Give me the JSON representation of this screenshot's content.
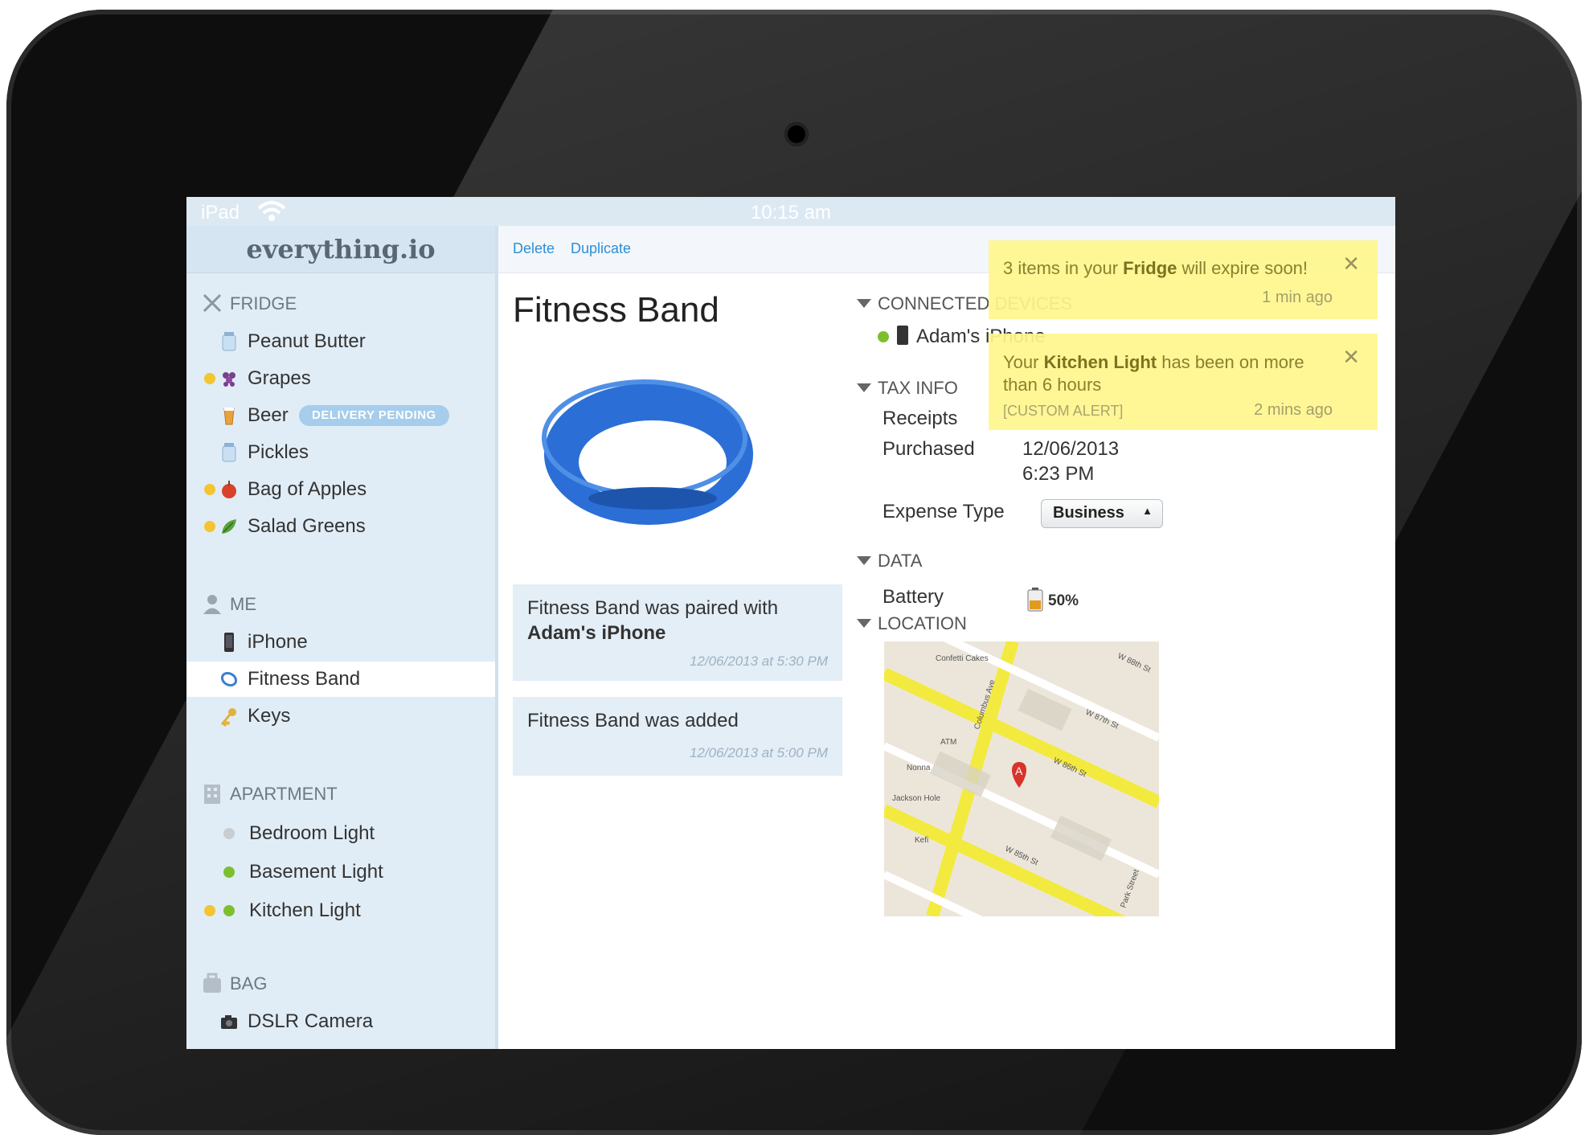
{
  "status_bar": {
    "carrier": "iPad",
    "time": "10:15 am"
  },
  "brand": "everything.io",
  "toolbar": {
    "delete_label": "Delete",
    "duplicate_label": "Duplicate"
  },
  "sidebar": {
    "fridge": {
      "header": "FRIDGE",
      "items": [
        {
          "label": "Peanut Butter",
          "icon": "jar-icon"
        },
        {
          "label": "Grapes",
          "icon": "grapes-icon",
          "alert_dot": true
        },
        {
          "label": "Beer",
          "icon": "beer-icon",
          "badge": "DELIVERY PENDING"
        },
        {
          "label": "Pickles",
          "icon": "jar-icon"
        },
        {
          "label": "Bag of Apples",
          "icon": "apple-icon",
          "alert_dot": true
        },
        {
          "label": "Salad Greens",
          "icon": "greens-icon",
          "alert_dot": true
        }
      ]
    },
    "me": {
      "header": "ME",
      "items": [
        {
          "label": "iPhone",
          "icon": "phone-icon"
        },
        {
          "label": "Fitness Band",
          "icon": "band-icon",
          "selected": true
        },
        {
          "label": "Keys",
          "icon": "key-icon"
        }
      ]
    },
    "apartment": {
      "header": "APARTMENT",
      "items": [
        {
          "label": "Bedroom Light",
          "status": "off"
        },
        {
          "label": "Basement Light",
          "status": "on"
        },
        {
          "label": "Kitchen Light",
          "status": "on",
          "alert_dot": true
        }
      ]
    },
    "bag": {
      "header": "BAG",
      "items": [
        {
          "label": "DSLR Camera",
          "icon": "camera-icon"
        }
      ]
    }
  },
  "detail": {
    "title": "Fitness Band",
    "feed": [
      {
        "text_plain": "Fitness Band was paired with",
        "text_bold": "Adam's iPhone",
        "timestamp": "12/06/2013 at 5:30 PM"
      },
      {
        "text_plain": "Fitness Band was added",
        "timestamp": "12/06/2013 at 5:00 PM"
      }
    ],
    "sections": {
      "connected_devices": {
        "header": "CONNECTED DEVICES",
        "device": "Adam's iPhone"
      },
      "tax_info": {
        "header": "TAX INFO",
        "receipts_label": "Receipts",
        "purchased_label": "Purchased",
        "purchased_date": "12/06/2013",
        "purchased_time": "6:23 PM",
        "expense_type_label": "Expense Type",
        "expense_type_value": "Business"
      },
      "data": {
        "header": "DATA",
        "battery_label": "Battery",
        "battery_value": "50%",
        "battery_level": 0.5
      },
      "location": {
        "header": "LOCATION",
        "streets": [
          "W 88th St",
          "W 87th St",
          "W 86th St",
          "W 85th St",
          "Columbus Ave"
        ],
        "marker_label": "A",
        "map_labels": [
          "Confetti Cakes",
          "ATM",
          "Nonna",
          "Jackson Hole",
          "Kefi",
          "Park Street"
        ]
      }
    }
  },
  "notifications": [
    {
      "pre": "3 items in your ",
      "bold": "Fridge",
      "post": " will expire soon!",
      "time": "1 min ago"
    },
    {
      "pre": "Your ",
      "bold": "Kitchen Light",
      "post": " has been on more than 6 hours",
      "tag": "[CUSTOM ALERT]",
      "time": "2 mins ago"
    }
  ],
  "colors": {
    "accent_blue": "#2d8fd5",
    "sidebar_bg": "#e1edf6",
    "alert_yellow": "#f4c431",
    "status_green": "#7dbf2e",
    "toast_bg": "#fff68c"
  }
}
